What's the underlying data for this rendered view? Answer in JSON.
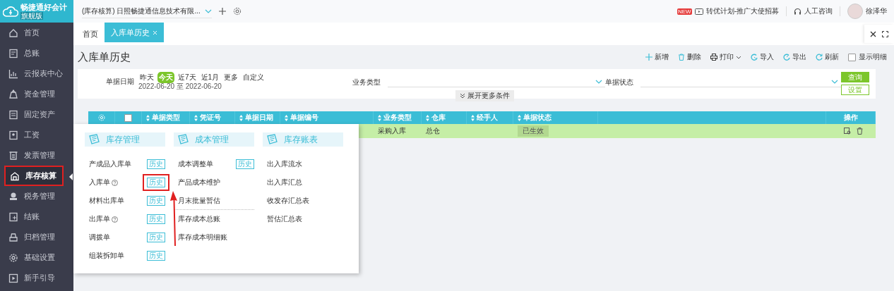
{
  "app": {
    "logo_name": "畅捷通好会计",
    "edition": "旗舰版"
  },
  "account_selector": {
    "value": "(库存核算) 日照畅捷通信息技术有限..."
  },
  "header": {
    "promo_badge": "NEW",
    "promo": "转优计划-推广大使招募",
    "support": "人工咨询",
    "user": "徐泽华"
  },
  "sidebar": {
    "items": [
      {
        "label": "首页",
        "selected": false,
        "annotated": false
      },
      {
        "label": "总账",
        "selected": false,
        "annotated": false
      },
      {
        "label": "云报表中心",
        "selected": false,
        "annotated": false
      },
      {
        "label": "资金管理",
        "selected": false,
        "annotated": false
      },
      {
        "label": "固定资产",
        "selected": false,
        "annotated": false
      },
      {
        "label": "工资",
        "selected": false,
        "annotated": false
      },
      {
        "label": "发票管理",
        "selected": false,
        "annotated": false
      },
      {
        "label": "库存核算",
        "selected": true,
        "annotated": true
      },
      {
        "label": "税务管理",
        "selected": false,
        "annotated": false
      },
      {
        "label": "结账",
        "selected": false,
        "annotated": false
      },
      {
        "label": "归档管理",
        "selected": false,
        "annotated": false
      },
      {
        "label": "基础设置",
        "selected": false,
        "annotated": false
      },
      {
        "label": "新手引导",
        "selected": false,
        "annotated": false
      }
    ]
  },
  "tabs": [
    {
      "label": "首页",
      "selected": false,
      "closable": false
    },
    {
      "label": "入库单历史",
      "selected": true,
      "closable": true
    }
  ],
  "page_title": "入库单历史",
  "toolbar": [
    {
      "kind": "new",
      "label": "新增"
    },
    {
      "kind": "delete",
      "label": "删除"
    },
    {
      "kind": "print",
      "label": "打印"
    },
    {
      "kind": "import",
      "label": "导入"
    },
    {
      "kind": "export",
      "label": "导出"
    },
    {
      "kind": "refresh",
      "label": "刷新"
    }
  ],
  "show_details": {
    "label": "显示明细",
    "checked": false
  },
  "filters": {
    "date_label": "单据日期",
    "quick_dates": [
      {
        "label": "昨天",
        "selected": false
      },
      {
        "label": "今天",
        "selected": true
      },
      {
        "label": "近7天",
        "selected": false
      },
      {
        "label": "近1月",
        "selected": false
      },
      {
        "label": "更多",
        "selected": false
      },
      {
        "label": "自定义",
        "selected": false
      }
    ],
    "date_range": "2022-06-20 至 2022-06-20",
    "business_type_label": "业务类型",
    "status_label": "单据状态",
    "expand": "展开更多条件",
    "query": "查询",
    "settings": "设置"
  },
  "table": {
    "select_all": {
      "checked": false
    },
    "columns": [
      "单据类型",
      "凭证号",
      "单据日期",
      "单据编号",
      "业务类型",
      "仓库",
      "经手人",
      "单据状态",
      "操作"
    ],
    "rows": [
      {
        "cells": [
          "",
          "",
          "",
          "",
          "采购入库",
          "总仓",
          "",
          "已生效"
        ],
        "selected": true
      }
    ]
  },
  "menu": {
    "sections": [
      {
        "title": "库存管理",
        "items": [
          {
            "label": "产成品入库单",
            "help": false,
            "history": "历史",
            "annotated": false
          },
          {
            "label": "入库单",
            "help": true,
            "history": "历史",
            "annotated": true
          },
          {
            "label": "材料出库单",
            "help": false,
            "history": "历史",
            "annotated": false
          },
          {
            "label": "出库单",
            "help": true,
            "history": "历史",
            "annotated": false
          },
          {
            "label": "调拨单",
            "help": false,
            "history": "历史",
            "annotated": false
          },
          {
            "label": "组装拆卸单",
            "help": false,
            "history": "历史",
            "annotated": false
          }
        ]
      },
      {
        "title": "成本管理",
        "items": [
          {
            "label": "成本调整单",
            "help": false,
            "history": "历史",
            "annotated": false
          },
          {
            "label": "产品成本维护",
            "help": false,
            "annotated": false
          },
          {
            "label": "月末批量暂估",
            "help": false,
            "annotated": false
          },
          {
            "label": "库存成本总账",
            "help": false,
            "annotated": false
          },
          {
            "label": "库存成本明细账",
            "help": false,
            "annotated": false
          }
        ]
      },
      {
        "title": "库存账表",
        "items": [
          {
            "label": "出入库流水",
            "help": false,
            "annotated": false
          },
          {
            "label": "出入库汇总",
            "help": false,
            "annotated": false
          },
          {
            "label": "收发存汇总表",
            "help": false,
            "annotated": false
          },
          {
            "label": "暂估汇总表",
            "help": false,
            "annotated": false
          }
        ]
      }
    ]
  }
}
